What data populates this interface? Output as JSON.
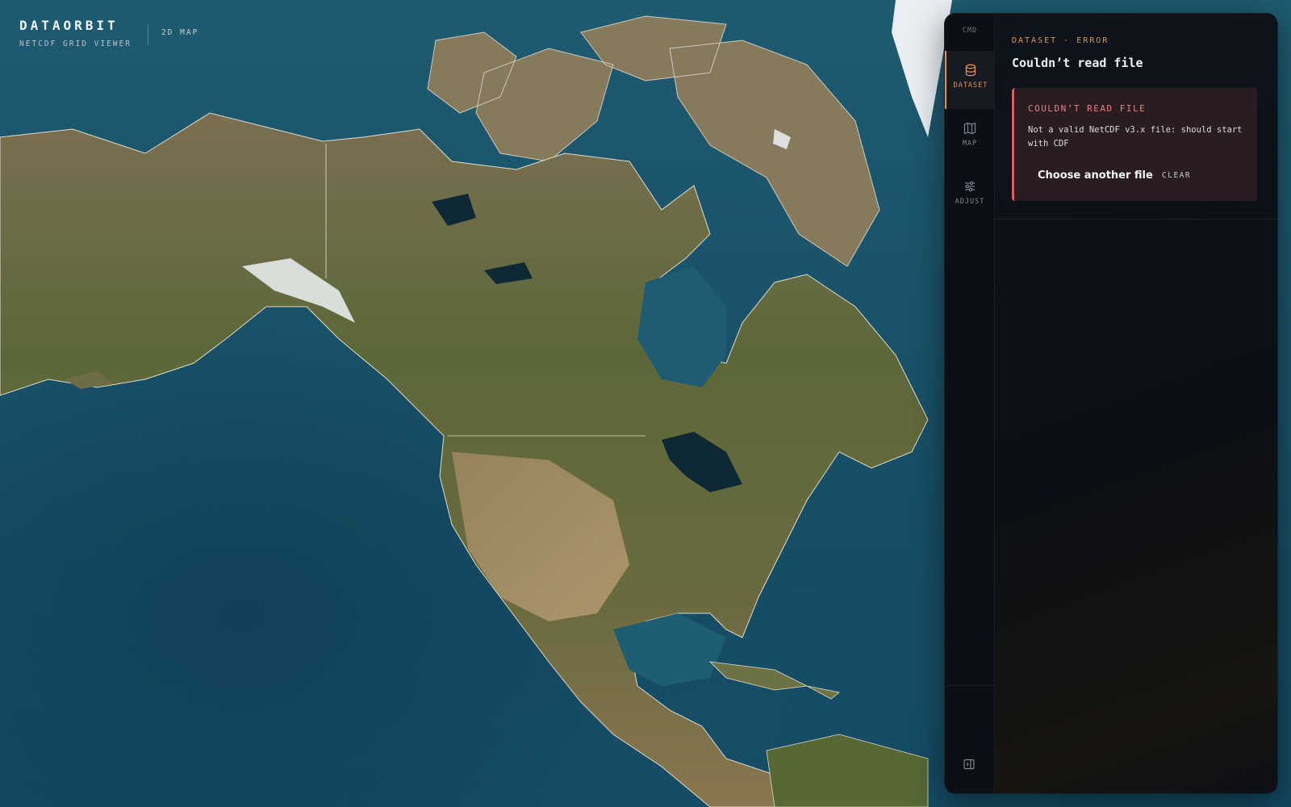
{
  "brand": {
    "title": "DATAORBIT",
    "subtitle": "NETCDF GRID VIEWER",
    "mode": "2D MAP"
  },
  "rail": {
    "cmd_label": "CMD",
    "items": [
      {
        "label": "DATASET",
        "icon": "database-icon",
        "active": true
      },
      {
        "label": "MAP",
        "icon": "map-icon",
        "active": false
      },
      {
        "label": "ADJUST",
        "icon": "sliders-icon",
        "active": false
      }
    ],
    "collapse_icon": "panel-collapse-icon"
  },
  "panel": {
    "eyebrow": "DATASET · ERROR",
    "title": "Couldn’t read file",
    "error": {
      "title": "COULDN’T READ FILE",
      "message": "Not a valid NetCDF v3.x file: should start with CDF"
    },
    "actions": {
      "choose_label": "Choose another file",
      "clear_label": "CLEAR"
    }
  },
  "colors": {
    "accent": "#e0954a",
    "error": "#f07b84",
    "error_bg": "#2a1d22",
    "panel_bg": "#0b0f16",
    "ocean": "#1a5269",
    "land": "#5f6a3c"
  }
}
